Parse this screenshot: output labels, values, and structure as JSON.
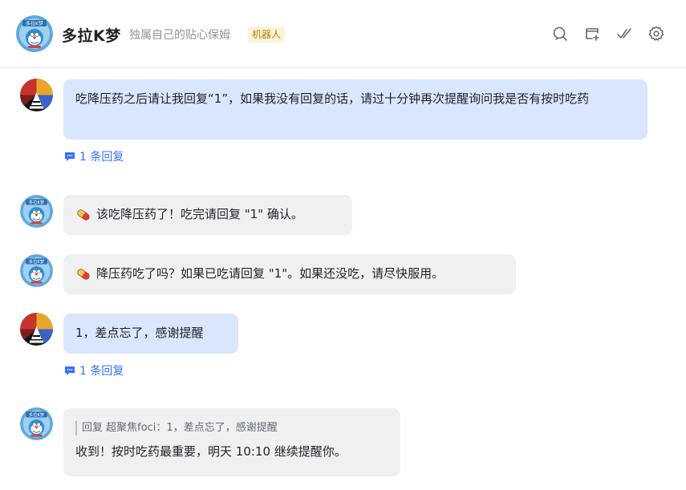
{
  "header": {
    "title": "多拉K梦",
    "subtitle": "独属自己的贴心保姆",
    "badge": "机器人",
    "icons": [
      "search-icon",
      "add-window-icon",
      "check-done-icon",
      "settings-gear-icon"
    ]
  },
  "messages": [
    {
      "sender": "user",
      "text": "吃降压药之后请让我回复“1”，如果我没有回复的话，请过十分钟再次提醒询问我是否有按时吃药",
      "reply_count": "1 条回复"
    },
    {
      "sender": "bot",
      "icon": "pill-icon",
      "text": "该吃降压药了！吃完请回复 \"1\" 确认。"
    },
    {
      "sender": "bot",
      "icon": "pill-icon",
      "text": "降压药吃了吗？如果已吃请回复 \"1\"。如果还没吃，请尽快服用。"
    },
    {
      "sender": "user",
      "text": "1，差点忘了，感谢提醒",
      "reply_count": "1 条回复"
    },
    {
      "sender": "bot",
      "quote": "回复 超聚焦foci：1，差点忘了，感谢提醒",
      "text": "收到！按时吃药最重要，明天 10:10 继续提醒你。"
    }
  ],
  "colors": {
    "user_bubble": "#d9e6fd",
    "bot_bubble": "#eff0f1",
    "link": "#3370ff",
    "badge_bg": "#fdf3d6",
    "badge_text": "#b4800c"
  }
}
